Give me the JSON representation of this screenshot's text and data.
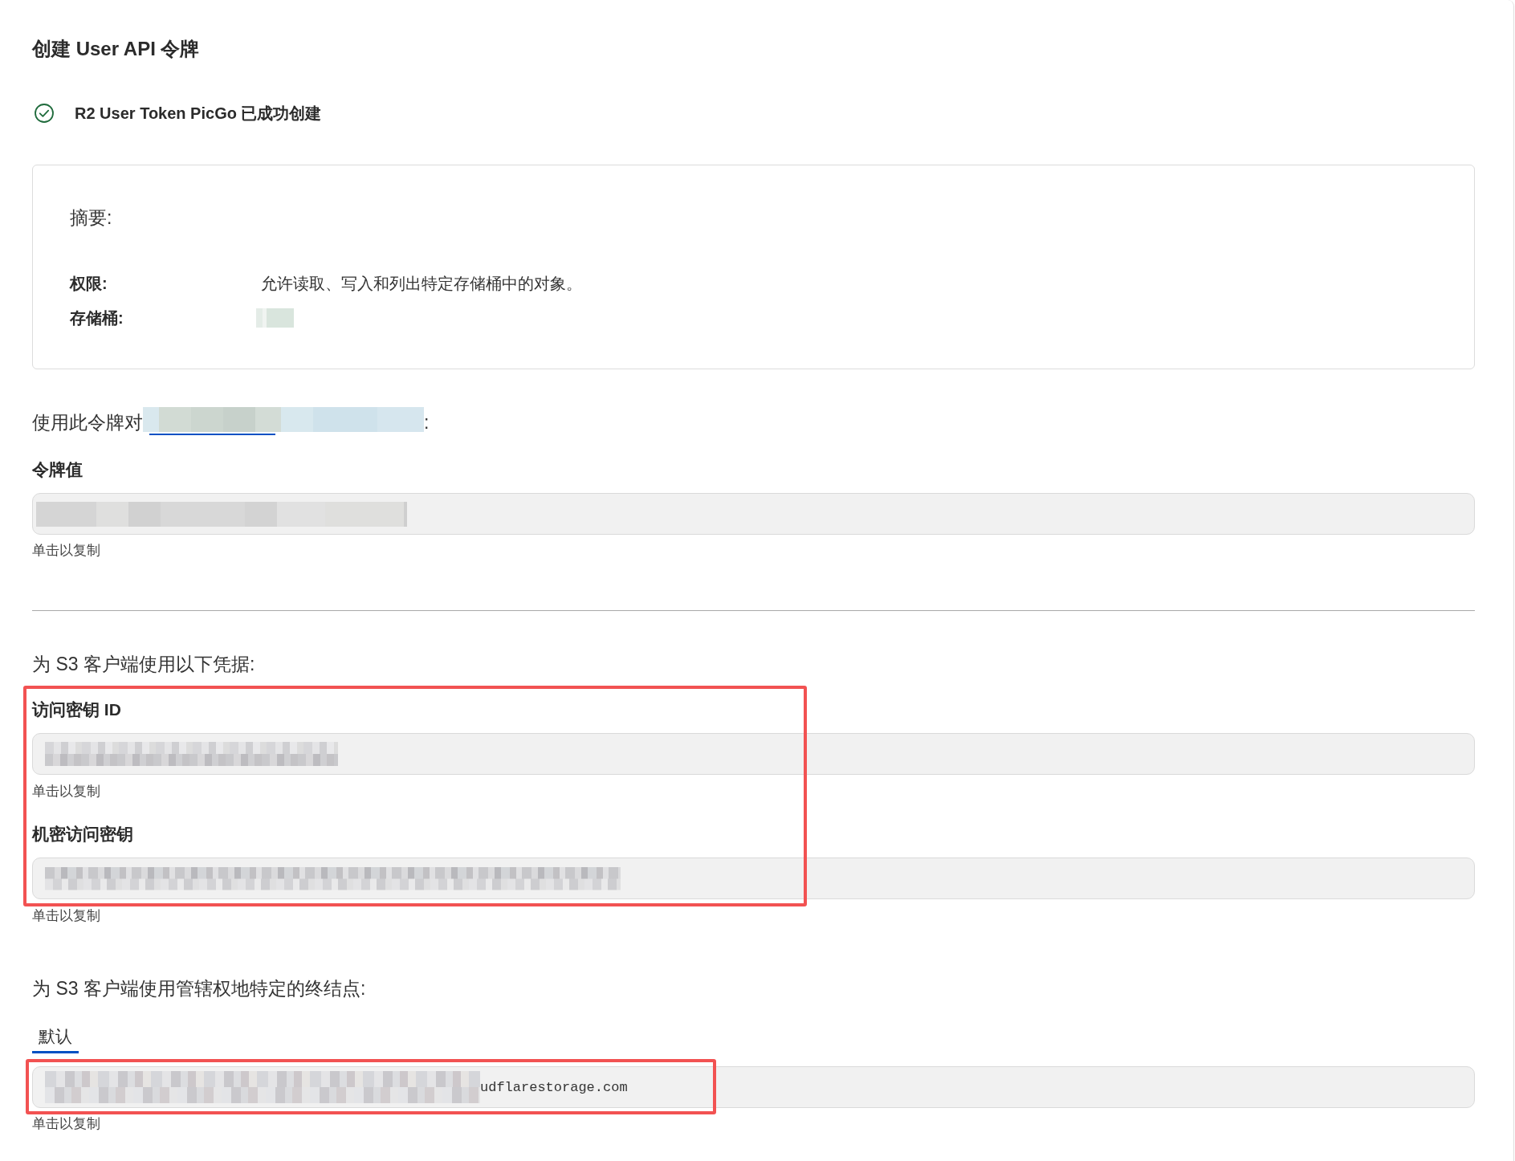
{
  "page": {
    "title": "创建 User API 令牌"
  },
  "notice": {
    "kind": "success",
    "message": "R2 User Token PicGo 已成功创建"
  },
  "summary": {
    "heading": "摘要:",
    "rows": [
      {
        "label": "权限:",
        "value": "允许读取、写入和列出特定存储桶中的对象。",
        "redacted": false
      },
      {
        "label": "存储桶:",
        "redacted": true
      }
    ]
  },
  "usage": {
    "prefix": "使用此令牌对",
    "link_redacted": true,
    "suffix": ":"
  },
  "token": {
    "label": "令牌值",
    "redacted": true,
    "hint": "单击以复制"
  },
  "credentials": {
    "heading": "为 S3 客户端使用以下凭据:",
    "highlighted": true,
    "fields": [
      {
        "label": "访问密钥 ID",
        "redacted": true,
        "hint": "单击以复制"
      },
      {
        "label": "机密访问密钥",
        "redacted": true,
        "hint": "单击以复制"
      }
    ]
  },
  "endpoint": {
    "heading": "为 S3 客户端使用管辖权地特定的终结点:",
    "tabs": [
      {
        "label": "默认",
        "selected": true
      }
    ],
    "field": {
      "value": "udflarestorage.com",
      "redacted": true,
      "highlighted": true,
      "hint": "单击以复制"
    }
  }
}
